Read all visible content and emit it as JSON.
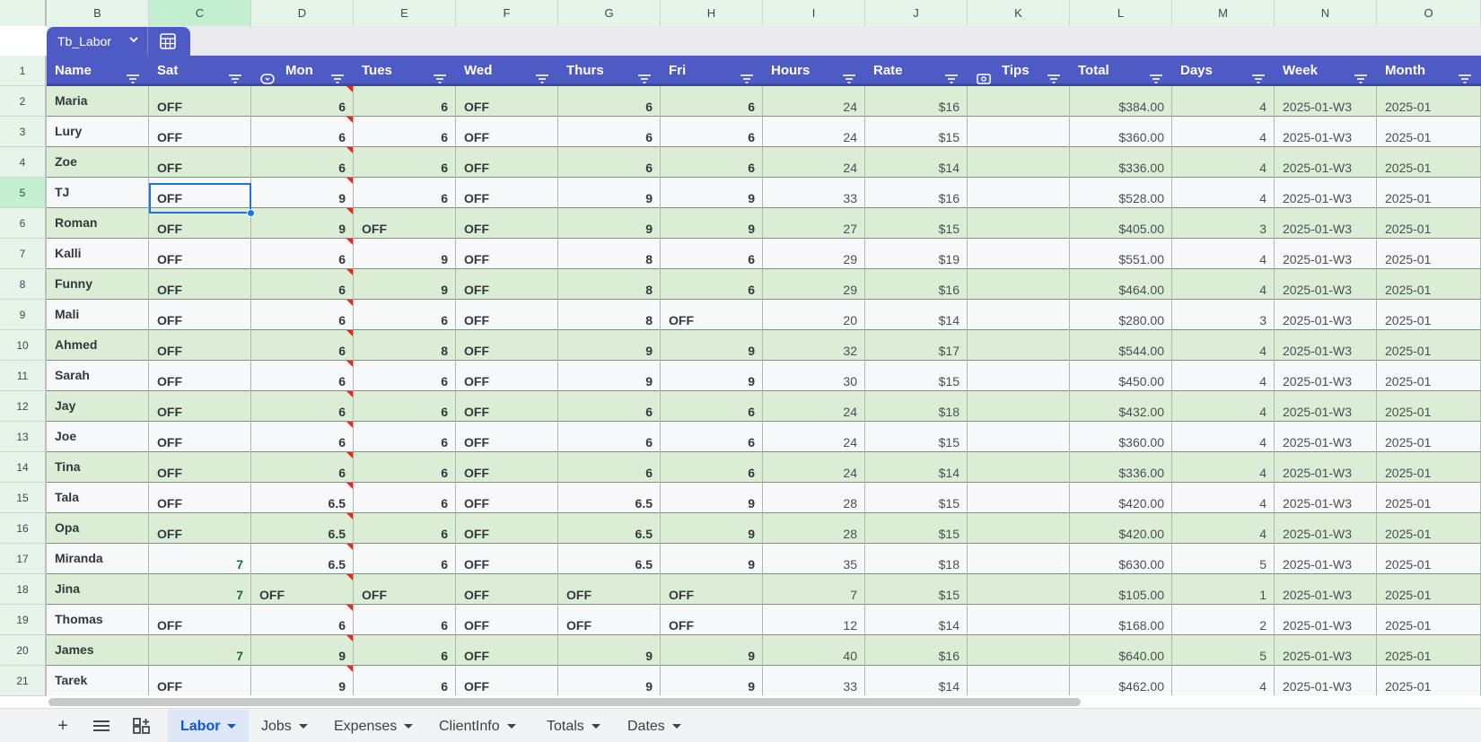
{
  "column_letters": [
    "B",
    "C",
    "D",
    "E",
    "F",
    "G",
    "H",
    "I",
    "J",
    "K",
    "L",
    "M",
    "N",
    "O"
  ],
  "selected_column": "C",
  "table": {
    "name": "Tb_Labor",
    "headers": [
      "Name",
      "Sat",
      "Mon",
      "Tues",
      "Wed",
      "Thurs",
      "Fri",
      "Hours",
      "Rate",
      "Tips",
      "Total",
      "Days",
      "Week",
      "Month"
    ]
  },
  "row_numbers": [
    "1",
    "2",
    "3",
    "4",
    "5",
    "6",
    "7",
    "8",
    "9",
    "10",
    "11",
    "12",
    "13",
    "14",
    "15",
    "16",
    "17",
    "18",
    "19",
    "20",
    "21"
  ],
  "selected_row": "5",
  "rows": [
    [
      "Maria",
      "OFF",
      "6",
      "6",
      "OFF",
      "6",
      "6",
      "24",
      "$16",
      "",
      "$384.00",
      "4",
      "2025-01-W3",
      "2025-01"
    ],
    [
      "Lury",
      "OFF",
      "6",
      "6",
      "OFF",
      "6",
      "6",
      "24",
      "$15",
      "",
      "$360.00",
      "4",
      "2025-01-W3",
      "2025-01"
    ],
    [
      "Zoe",
      "OFF",
      "6",
      "6",
      "OFF",
      "6",
      "6",
      "24",
      "$14",
      "",
      "$336.00",
      "4",
      "2025-01-W3",
      "2025-01"
    ],
    [
      "TJ",
      "OFF",
      "9",
      "6",
      "OFF",
      "9",
      "9",
      "33",
      "$16",
      "",
      "$528.00",
      "4",
      "2025-01-W3",
      "2025-01"
    ],
    [
      "Roman",
      "OFF",
      "9",
      "OFF",
      "OFF",
      "9",
      "9",
      "27",
      "$15",
      "",
      "$405.00",
      "3",
      "2025-01-W3",
      "2025-01"
    ],
    [
      "Kalli",
      "OFF",
      "6",
      "9",
      "OFF",
      "8",
      "6",
      "29",
      "$19",
      "",
      "$551.00",
      "4",
      "2025-01-W3",
      "2025-01"
    ],
    [
      "Funny",
      "OFF",
      "6",
      "9",
      "OFF",
      "8",
      "6",
      "29",
      "$16",
      "",
      "$464.00",
      "4",
      "2025-01-W3",
      "2025-01"
    ],
    [
      "Mali",
      "OFF",
      "6",
      "6",
      "OFF",
      "8",
      "OFF",
      "20",
      "$14",
      "",
      "$280.00",
      "3",
      "2025-01-W3",
      "2025-01"
    ],
    [
      "Ahmed",
      "OFF",
      "6",
      "8",
      "OFF",
      "9",
      "9",
      "32",
      "$17",
      "",
      "$544.00",
      "4",
      "2025-01-W3",
      "2025-01"
    ],
    [
      "Sarah",
      "OFF",
      "6",
      "6",
      "OFF",
      "9",
      "9",
      "30",
      "$15",
      "",
      "$450.00",
      "4",
      "2025-01-W3",
      "2025-01"
    ],
    [
      "Jay",
      "OFF",
      "6",
      "6",
      "OFF",
      "6",
      "6",
      "24",
      "$18",
      "",
      "$432.00",
      "4",
      "2025-01-W3",
      "2025-01"
    ],
    [
      "Joe",
      "OFF",
      "6",
      "6",
      "OFF",
      "6",
      "6",
      "24",
      "$15",
      "",
      "$360.00",
      "4",
      "2025-01-W3",
      "2025-01"
    ],
    [
      "Tina",
      "OFF",
      "6",
      "6",
      "OFF",
      "6",
      "6",
      "24",
      "$14",
      "",
      "$336.00",
      "4",
      "2025-01-W3",
      "2025-01"
    ],
    [
      "Tala",
      "OFF",
      "6.5",
      "6",
      "OFF",
      "6.5",
      "9",
      "28",
      "$15",
      "",
      "$420.00",
      "4",
      "2025-01-W3",
      "2025-01"
    ],
    [
      "Opa",
      "OFF",
      "6.5",
      "6",
      "OFF",
      "6.5",
      "9",
      "28",
      "$15",
      "",
      "$420.00",
      "4",
      "2025-01-W3",
      "2025-01"
    ],
    [
      "Miranda",
      "7",
      "6.5",
      "6",
      "OFF",
      "6.5",
      "9",
      "35",
      "$18",
      "",
      "$630.00",
      "5",
      "2025-01-W3",
      "2025-01"
    ],
    [
      "Jina",
      "7",
      "OFF",
      "OFF",
      "OFF",
      "OFF",
      "OFF",
      "7",
      "$15",
      "",
      "$105.00",
      "1",
      "2025-01-W3",
      "2025-01"
    ],
    [
      "Thomas",
      "OFF",
      "6",
      "6",
      "OFF",
      "OFF",
      "OFF",
      "12",
      "$14",
      "",
      "$168.00",
      "2",
      "2025-01-W3",
      "2025-01"
    ],
    [
      "James",
      "7",
      "9",
      "6",
      "OFF",
      "9",
      "9",
      "40",
      "$16",
      "",
      "$640.00",
      "5",
      "2025-01-W3",
      "2025-01"
    ],
    [
      "Tarek",
      "OFF",
      "9",
      "6",
      "OFF",
      "9",
      "9",
      "33",
      "$14",
      "",
      "$462.00",
      "4",
      "2025-01-W3",
      "2025-01"
    ]
  ],
  "sheet_tabs": [
    "Labor",
    "Jobs",
    "Expenses",
    "ClientInfo",
    "Totals",
    "Dates"
  ],
  "active_tab": "Labor",
  "colors": {
    "table_header": "#4e5bc4",
    "band_even": "#dbeed5",
    "band_odd": "#f7f8fa",
    "selection": "#1a73e8",
    "comment_flag": "#d93025"
  },
  "icons": [
    "filter-icon",
    "dropdown-column-icon",
    "tips-column-icon",
    "calculator-icon",
    "add-sheet-icon",
    "all-sheets-icon",
    "sheet-groups-icon"
  ]
}
